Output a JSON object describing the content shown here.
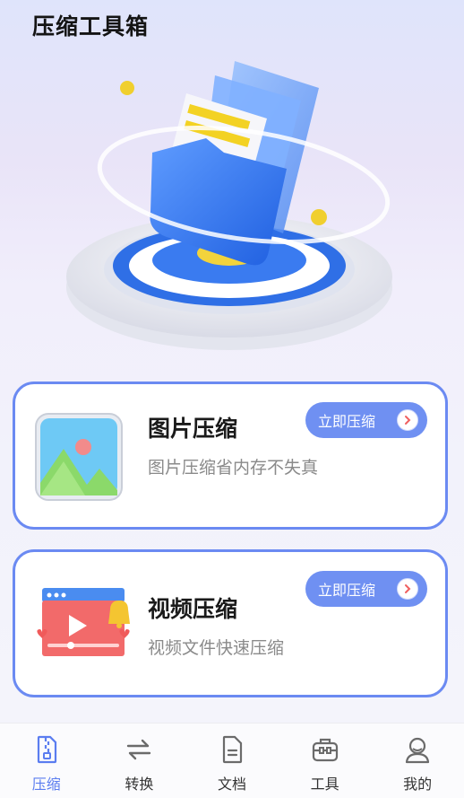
{
  "header": {
    "title": "压缩工具箱"
  },
  "cards": [
    {
      "title": "图片压缩",
      "desc": "图片压缩省内存不失真",
      "cta": "立即压缩",
      "icon": "image-compress-icon"
    },
    {
      "title": "视频压缩",
      "desc": "视频文件快速压缩",
      "cta": "立即压缩",
      "icon": "video-compress-icon"
    }
  ],
  "tabs": [
    {
      "label": "压缩",
      "icon": "zip-file-icon",
      "active": true
    },
    {
      "label": "转换",
      "icon": "convert-arrows-icon",
      "active": false
    },
    {
      "label": "文档",
      "icon": "document-icon",
      "active": false
    },
    {
      "label": "工具",
      "icon": "toolbox-icon",
      "active": false
    },
    {
      "label": "我的",
      "icon": "user-icon",
      "active": false
    }
  ],
  "colors": {
    "accent": "#5b7df0",
    "card_border": "#6b8af2",
    "button": "#6f90f2"
  }
}
